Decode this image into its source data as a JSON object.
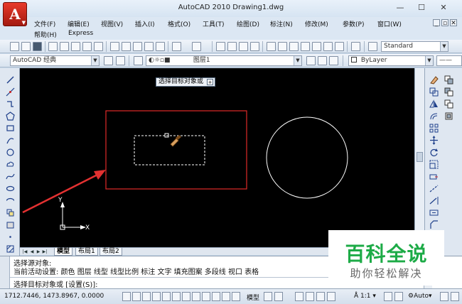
{
  "window": {
    "app_letter": "A",
    "title": "AutoCAD 2010      Drawing1.dwg",
    "min_symbol": "—",
    "max_symbol": "☐",
    "close_symbol": "✕"
  },
  "menus": [
    {
      "label": "文件(F)"
    },
    {
      "label": "编辑(E)"
    },
    {
      "label": "视图(V)"
    },
    {
      "label": "插入(I)"
    },
    {
      "label": "格式(O)"
    },
    {
      "label": "工具(T)"
    },
    {
      "label": "绘图(D)"
    },
    {
      "label": "标注(N)"
    },
    {
      "label": "修改(M)"
    },
    {
      "label": "参数(P)"
    },
    {
      "label": "窗口(W)"
    }
  ],
  "menus_row2": [
    {
      "label": "帮助(H)"
    },
    {
      "label": "Express"
    }
  ],
  "toolbar": {
    "text_style_value": "Standard",
    "workspace_value": "AutoCAD 经典",
    "layer_value": "图层1",
    "color_value": "ByLayer"
  },
  "canvas": {
    "tooltip_text": "选择目标对象或",
    "tooltip_btn": "+",
    "ucs_y": "Y",
    "ucs_x": "X"
  },
  "tabs": [
    {
      "label": "模型",
      "active": true
    },
    {
      "label": "布局1",
      "active": false
    },
    {
      "label": "布局2",
      "active": false
    }
  ],
  "command": {
    "line1": "选择源对象:",
    "line2": "当前活动设置:  颜色 图层 线型 线型比例 标注 文字 填充图案 多段线 视口 表格",
    "line3": "选择目标对象或 [设置(S)]:"
  },
  "status": {
    "coords": "1712.7446, 1473.8967, 0.0000",
    "model_label": "模型",
    "scale_label": "1:1",
    "auto_label": "Auto"
  },
  "watermark": {
    "title": "百科全说",
    "subtitle": "助你轻松解决"
  },
  "colors": {
    "red_rect": "#e02a28",
    "arrow": "#e33131",
    "canvas_bg": "#000000",
    "watermark_green": "#1dab47"
  }
}
